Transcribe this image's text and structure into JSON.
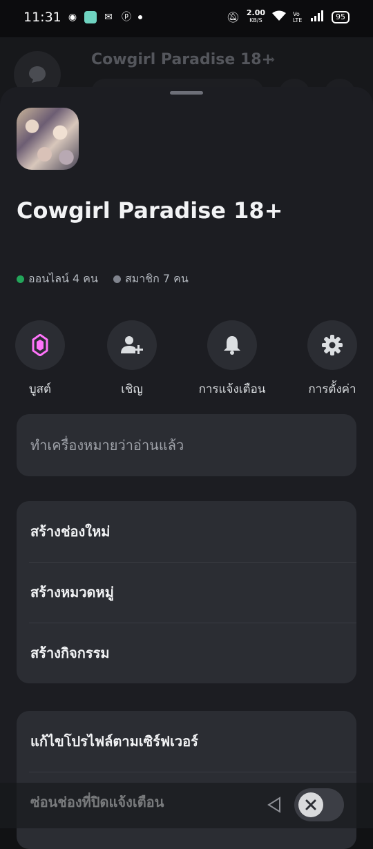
{
  "status_bar": {
    "time": "11:31",
    "network_speed": "2.00",
    "network_unit": "KB/S",
    "volte": "Vo LTE",
    "battery": "95"
  },
  "background": {
    "server_title": "Cowgirl Paradise 18+"
  },
  "server": {
    "name": "Cowgirl Paradise 18+",
    "online_label": "ออนไลน์ 4 คน",
    "members_label": "สมาชิก 7 คน",
    "online_color": "#23a55a",
    "members_color": "#80848e"
  },
  "actions": [
    {
      "label": "บูสต์",
      "icon": "boost-gem-icon",
      "color": "#ff73fa"
    },
    {
      "label": "เชิญ",
      "icon": "invite-user-icon"
    },
    {
      "label": "การแจ้งเตือน",
      "icon": "bell-icon"
    },
    {
      "label": "การตั้งค่า",
      "icon": "gear-icon"
    }
  ],
  "menu": {
    "mark_read": "ทำเครื่องหมายว่าอ่านแล้ว",
    "create_channel": "สร้างช่องใหม่",
    "create_category": "สร้างหมวดหมู่",
    "create_event": "สร้างกิจกรรม",
    "edit_server_profile": "แก้ไขโปรไฟล์ตามเซิร์ฟเวอร์",
    "hide_muted_channels": "ซ่อนช่องที่ปิดแจ้งเตือน"
  }
}
